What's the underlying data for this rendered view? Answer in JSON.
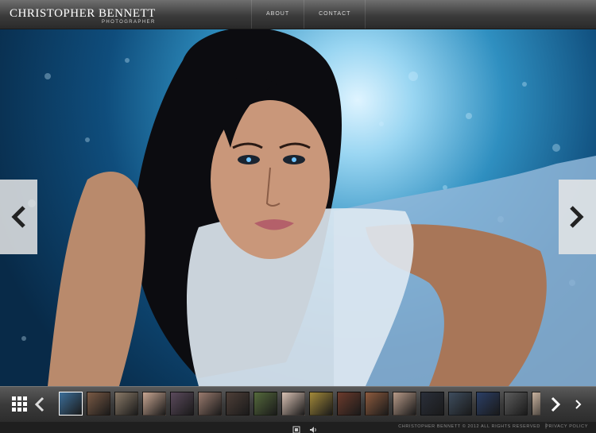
{
  "header": {
    "brand_name": "CHRISTOPHER BENNETT",
    "brand_tagline": "PHOTOGRAPHER",
    "nav": [
      {
        "label": "ABOUT"
      },
      {
        "label": "CONTACT"
      }
    ]
  },
  "hero": {
    "image": "portrait-photo",
    "prev_icon": "chevron-left-icon",
    "next_icon": "chevron-right-icon"
  },
  "strip": {
    "grid_icon": "grid-icon",
    "prev_icon": "chevron-left-icon",
    "next_icon": "chevron-right-icon",
    "end_icon": "chevron-right-small-icon",
    "thumb_colors": [
      "#3d6f9a",
      "#7a5a45",
      "#8a7a68",
      "#c8a692",
      "#5b4a5c",
      "#9a7b6e",
      "#4e3f38",
      "#556a3c",
      "#d9c2b4",
      "#a38a3a",
      "#6c3b2c",
      "#8e5b3e",
      "#b79a88",
      "#2a2f3a",
      "#3e4d5e",
      "#2b3f66",
      "#5d5d5d",
      "#c9b39f"
    ]
  },
  "footer": {
    "fullscreen_icon": "fullscreen-icon",
    "sound_icon": "speaker-icon",
    "copyright": "CHRISTOPHER BENNETT © 2012 ALL RIGHTS RESERVED",
    "divider": "|",
    "privacy": "PRIVACY POLICY"
  },
  "colors": {
    "accent": "#2f8fc0",
    "bar": "#3a3a3a"
  }
}
